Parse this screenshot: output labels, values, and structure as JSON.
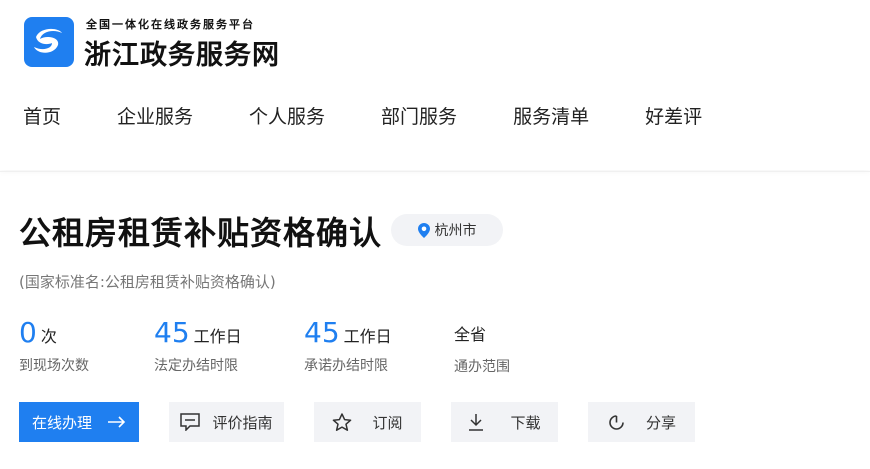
{
  "header": {
    "slogan": "全国一体化在线政务服务平台",
    "site_name": "浙江政务服务网",
    "nav": [
      "首页",
      "企业服务",
      "个人服务",
      "部门服务",
      "服务清单",
      "好差评"
    ]
  },
  "service": {
    "title": "公租房租赁补贴资格确认",
    "location": "杭州市",
    "standard_name": "(国家标准名:公租房租赁补贴资格确认)",
    "stats": [
      {
        "value": "0",
        "unit": "次",
        "label": "到现场次数"
      },
      {
        "value": "45",
        "unit": "工作日",
        "label": "法定办结时限"
      },
      {
        "value": "45",
        "unit": "工作日",
        "label": "承诺办结时限"
      },
      {
        "value": "全省",
        "unit": "",
        "label": "通办范围"
      }
    ]
  },
  "actions": {
    "apply": "在线办理",
    "guide": "评价指南",
    "subscribe": "订阅",
    "download": "下载",
    "share": "分享"
  },
  "colors": {
    "brand": "#1f7ff0",
    "button_bg": "#f2f3f6"
  },
  "icons": [
    "logo-icon",
    "location-pin-icon",
    "arrow-right-icon",
    "comment-icon",
    "star-icon",
    "download-icon",
    "share-icon"
  ]
}
